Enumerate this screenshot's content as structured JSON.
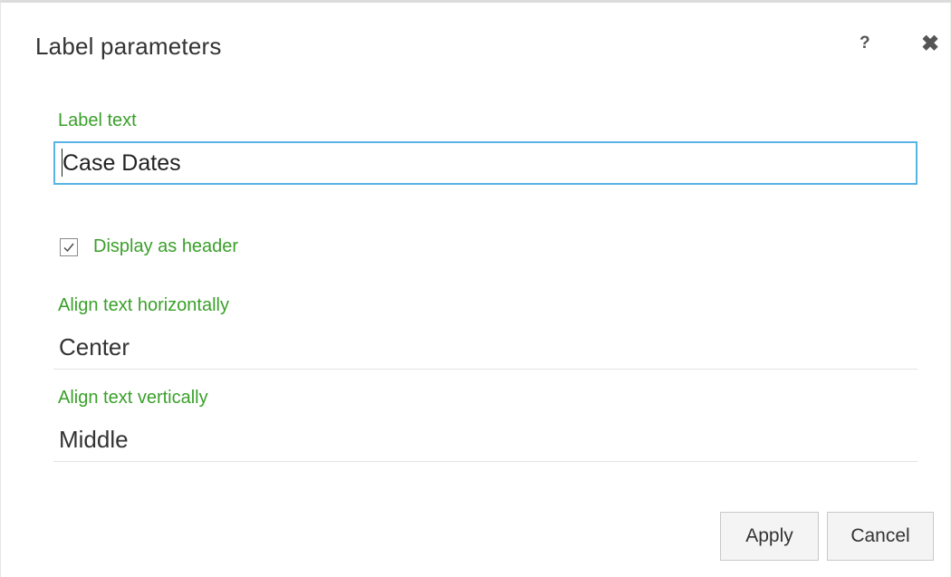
{
  "dialog": {
    "title": "Label parameters",
    "help_label": "?",
    "close_label": "✖"
  },
  "label_text": {
    "label": "Label text",
    "value": "Case Dates"
  },
  "display_as_header": {
    "label": "Display as header",
    "checked": true
  },
  "align_horizontal": {
    "label": "Align text horizontally",
    "value": "Center"
  },
  "align_vertical": {
    "label": "Align text vertically",
    "value": "Middle"
  },
  "buttons": {
    "apply": "Apply",
    "cancel": "Cancel"
  },
  "colors": {
    "label_green": "#3aa02a",
    "input_focus_border": "#58b4e4"
  },
  "icons": {
    "help": "help-icon",
    "close": "close-icon",
    "checkbox": "checkmark-icon"
  }
}
